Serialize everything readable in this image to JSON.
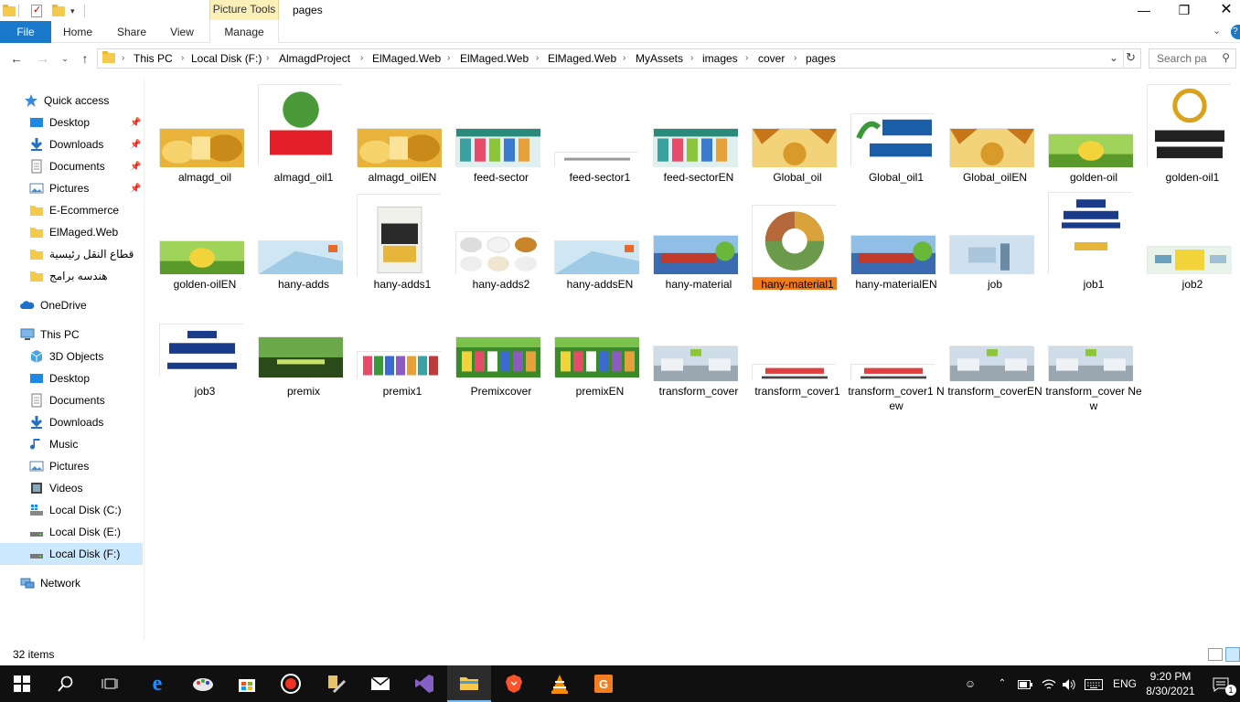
{
  "window": {
    "title": "pages",
    "context_tab_header": "Picture Tools"
  },
  "ribbon": {
    "tabs": [
      "File",
      "Home",
      "Share",
      "View",
      "Manage"
    ]
  },
  "address": {
    "crumbs": [
      "This PC",
      "Local Disk (F:)",
      "AlmagdProject",
      "ElMaged.Web",
      "ElMaged.Web",
      "ElMaged.Web",
      "MyAssets",
      "images",
      "cover",
      "pages"
    ],
    "search_placeholder": "Search pa"
  },
  "nav": {
    "quick_access": "Quick access",
    "quick_items": [
      "Desktop",
      "Downloads",
      "Documents",
      "Pictures",
      "E-Ecommerce",
      "ElMaged.Web",
      "قطاع النقل رئيسية",
      "هندسه برامج"
    ],
    "onedrive": "OneDrive",
    "thispc": "This PC",
    "pc_items": [
      "3D Objects",
      "Desktop",
      "Documents",
      "Downloads",
      "Music",
      "Pictures",
      "Videos",
      "Local Disk (C:)",
      "Local Disk (E:)",
      "Local Disk (F:)"
    ],
    "network": "Network"
  },
  "files": [
    {
      "name": "almagd_oil",
      "thumb": "golden"
    },
    {
      "name": "almagd_oil1",
      "thumb": "logo-almagd"
    },
    {
      "name": "almagd_oilEN",
      "thumb": "golden"
    },
    {
      "name": "feed-sector",
      "thumb": "feed"
    },
    {
      "name": "feed-sector1",
      "thumb": "white-text"
    },
    {
      "name": "feed-sectorEN",
      "thumb": "feed"
    },
    {
      "name": "Global_oil",
      "thumb": "leaves"
    },
    {
      "name": "Global_oil1",
      "thumb": "logo-global"
    },
    {
      "name": "Global_oilEN",
      "thumb": "leaves"
    },
    {
      "name": "golden-oil",
      "thumb": "green-yellow"
    },
    {
      "name": "golden-oil1",
      "thumb": "logo-golden"
    },
    {
      "name": "golden-oilEN",
      "thumb": "green-yellow"
    },
    {
      "name": "hany-adds",
      "thumb": "light-blue"
    },
    {
      "name": "hany-adds1",
      "thumb": "bag"
    },
    {
      "name": "hany-adds2",
      "thumb": "powders"
    },
    {
      "name": "hany-addsEN",
      "thumb": "light-blue"
    },
    {
      "name": "hany-material",
      "thumb": "ship"
    },
    {
      "name": "hany-material1",
      "thumb": "circle-infographic"
    },
    {
      "name": "hany-materialEN",
      "thumb": "ship"
    },
    {
      "name": "job",
      "thumb": "pale-blue"
    },
    {
      "name": "job1",
      "thumb": "job-text"
    },
    {
      "name": "job2",
      "thumb": "job-banner"
    },
    {
      "name": "job3",
      "thumb": "job-hr"
    },
    {
      "name": "premix",
      "thumb": "dark-green"
    },
    {
      "name": "premix1",
      "thumb": "bags-row"
    },
    {
      "name": "Premixcover",
      "thumb": "green-bags"
    },
    {
      "name": "premixEN",
      "thumb": "green-bags"
    },
    {
      "name": "transform_cover",
      "thumb": "trucks"
    },
    {
      "name": "transform_cover1",
      "thumb": "white-red-text"
    },
    {
      "name": "transform_cover1 New",
      "thumb": "white-red-text"
    },
    {
      "name": "transform_coverEN",
      "thumb": "trucks"
    },
    {
      "name": "transform_cover New",
      "thumb": "trucks"
    }
  ],
  "status": {
    "item_count": "32 items"
  },
  "taskbar": {
    "tray_lang": "ENG",
    "time": "9:20 PM",
    "date": "8/30/2021",
    "notif_count": "1"
  }
}
